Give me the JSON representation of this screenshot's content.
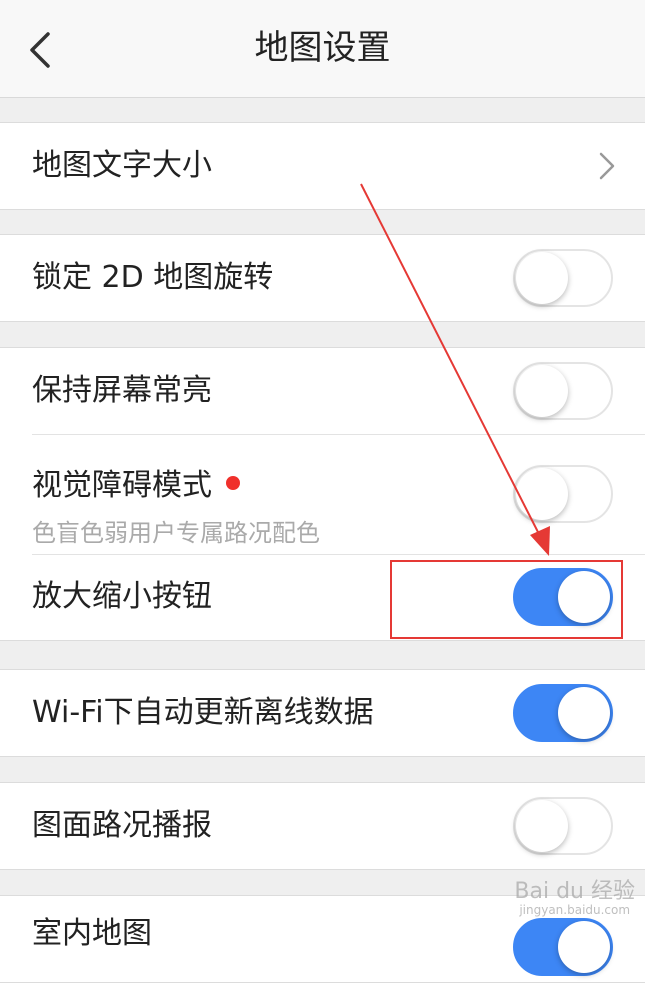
{
  "header": {
    "title": "地图设置",
    "back_icon": "chevron-left-icon"
  },
  "settings": {
    "text_size": {
      "label": "地图文字大小",
      "icon": "chevron-right-icon"
    },
    "lock_2d": {
      "label": "锁定 2D 地图旋转",
      "enabled": false
    },
    "keep_screen_on": {
      "label": "保持屏幕常亮",
      "enabled": false
    },
    "vision_mode": {
      "label": "视觉障碍模式",
      "subtitle": "色盲色弱用户专属路况配色",
      "enabled": false,
      "badge_color": "#f0302b"
    },
    "zoom_buttons": {
      "label": "放大缩小按钮",
      "enabled": true
    },
    "wifi_update": {
      "label": "Wi-Fi下自动更新离线数据",
      "enabled": true
    },
    "traffic_broadcast": {
      "label": "图面路况播报",
      "enabled": false
    },
    "last_item": {
      "label": "室内地图",
      "enabled": true
    }
  },
  "watermark": {
    "brand": "Bai du 经验",
    "url": "jingyan.baidu.com"
  },
  "colors": {
    "toggle_on": "#3d86f5",
    "annotation": "#e53935"
  }
}
